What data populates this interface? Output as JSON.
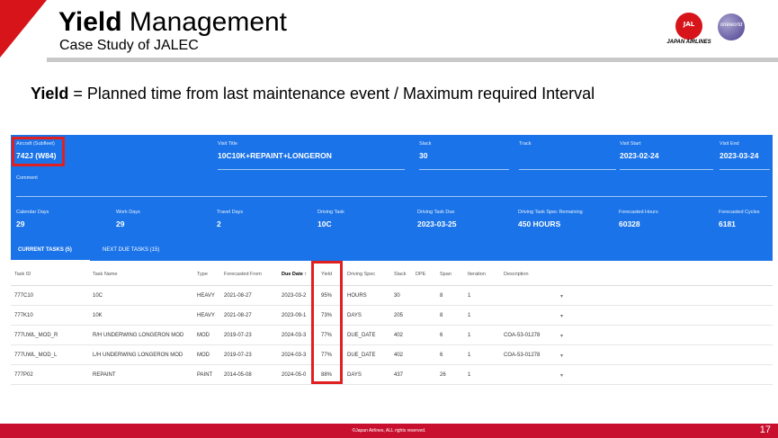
{
  "header": {
    "title_bold": "Yield",
    "title_rest": " Management",
    "subtitle": "Case Study of JALEC",
    "jal_logo_text": "JAPAN AIRLINES",
    "jal_crane_text": "JAL",
    "oneworld_text": "oneworld",
    "accent_color": "#d7141a"
  },
  "formula": {
    "bold": "Yield",
    "rest": " = Planned time from last  maintenance event / Maximum required Interval"
  },
  "app": {
    "primary_color": "#1a73e8",
    "fields": [
      {
        "label": "Aircraft (Subfleet)",
        "value": "742J (W84)"
      },
      {
        "label": "Visit Title",
        "value": "10C10K+REPAINT+LONGERON"
      },
      {
        "label": "Slack",
        "value": "30"
      },
      {
        "label": "Track",
        "value": ""
      },
      {
        "label": "Visit Start",
        "value": "2023-02-24"
      },
      {
        "label": "Visit End",
        "value": "2023-03-24"
      },
      {
        "label": "Comment",
        "value": ""
      },
      {
        "label": "Calendar Days",
        "value": "29"
      },
      {
        "label": "Work Days",
        "value": "29"
      },
      {
        "label": "Travel Days",
        "value": "2"
      },
      {
        "label": "Driving Task",
        "value": "10C"
      },
      {
        "label": "Driving Task Due",
        "value": "2023-03-25"
      },
      {
        "label": "Driving Task Spec Remaining",
        "value": "450 HOURS"
      },
      {
        "label": "Forecasted Hours",
        "value": "60328"
      },
      {
        "label": "Forecasted Cycles",
        "value": "6181"
      }
    ],
    "tabs": [
      {
        "label": "CURRENT TASKS (5)",
        "active": true
      },
      {
        "label": "NEXT DUE TASKS (15)",
        "active": false
      }
    ],
    "columns": [
      "Task ID",
      "Task Name",
      "Type",
      "Forecasted From",
      "Due Date ↑",
      "Yield",
      "Driving Spec",
      "Slack",
      "DPE",
      "Span",
      "Iteration",
      "Description"
    ],
    "rows": [
      [
        "777C10",
        "10C",
        "HEAVY",
        "2021-08-27",
        "2023-03-2",
        "95%",
        "HOURS",
        "30",
        "",
        "8",
        "1",
        ""
      ],
      [
        "777K10",
        "10K",
        "HEAVY",
        "2021-08-27",
        "2023-09-1",
        "73%",
        "DAYS",
        "205",
        "",
        "8",
        "1",
        ""
      ],
      [
        "777UWL_MOD_R",
        "R/H UNDERWING LONGERON MOD",
        "MOD",
        "2019-07-23",
        "2024-03-3",
        "77%",
        "DUE_DATE",
        "402",
        "",
        "6",
        "1",
        "COA-53-01278"
      ],
      [
        "777UWL_MOD_L",
        "L/H UNDERWING LONGERON MOD",
        "MOD",
        "2019-07-23",
        "2024-03-3",
        "77%",
        "DUE_DATE",
        "402",
        "",
        "6",
        "1",
        "COA-53-01278"
      ],
      [
        "777P02",
        "REPAINT",
        "PAINT",
        "2014-05-08",
        "2024-05-0",
        "88%",
        "DAYS",
        "437",
        "",
        "26",
        "1",
        ""
      ]
    ],
    "row_caret": "▾"
  },
  "footer": {
    "copyright": "©Japan Airlines, ALL rights reserved.",
    "page_number": "17",
    "color": "#c8102e"
  }
}
